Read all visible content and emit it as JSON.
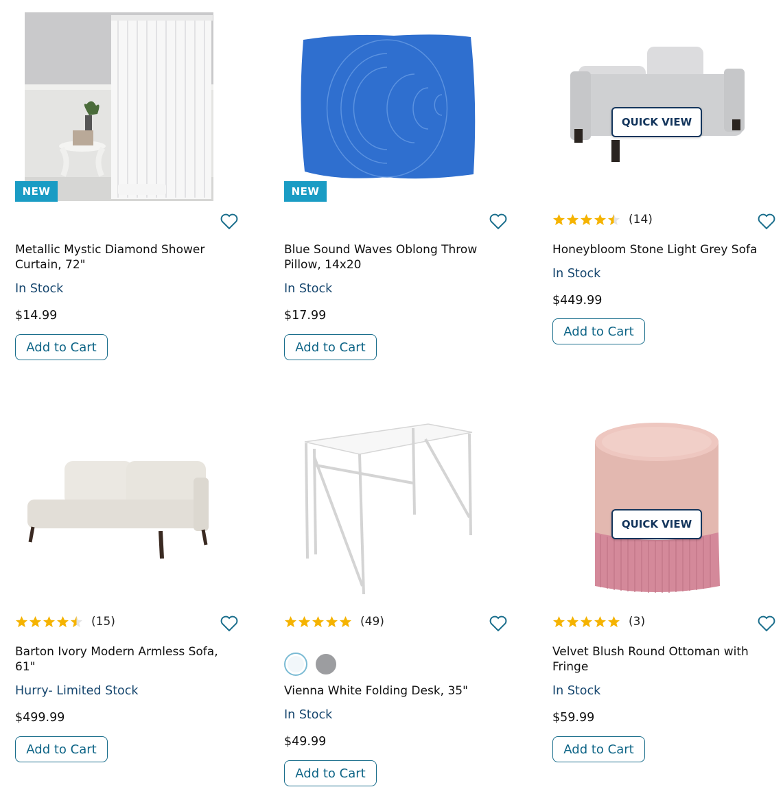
{
  "colors": {
    "accent": "#0d6486",
    "badge": "#1a9cc4",
    "stock": "#16466e",
    "star": "#f5b301"
  },
  "products": [
    {
      "badge": "NEW",
      "title": "Metallic Mystic Diamond Shower Curtain, 72\"",
      "stock": "In Stock",
      "price": "$14.99",
      "cart": "Add to Cart"
    },
    {
      "badge": "NEW",
      "title": "Blue Sound Waves Oblong Throw Pillow, 14x20",
      "stock": "In Stock",
      "price": "$17.99",
      "cart": "Add to Cart"
    },
    {
      "quick_view": "QUICK VIEW",
      "rating": 4.5,
      "rating_count": "(14)",
      "title": "Honeybloom Stone Light Grey Sofa",
      "stock": "In Stock",
      "price": "$449.99",
      "cart": "Add to Cart"
    },
    {
      "rating": 4.5,
      "rating_count": "(15)",
      "title": "Barton Ivory Modern Armless Sofa, 61\"",
      "stock": "Hurry- Limited Stock",
      "price": "$499.99",
      "cart": "Add to Cart"
    },
    {
      "rating": 5,
      "rating_count": "(49)",
      "swatches": [
        "white",
        "grey"
      ],
      "title": "Vienna White Folding Desk, 35\"",
      "stock": "In Stock",
      "price": "$49.99",
      "cart": "Add to Cart"
    },
    {
      "quick_view": "QUICK VIEW",
      "rating": 5,
      "rating_count": "(3)",
      "title": "Velvet Blush Round Ottoman with Fringe",
      "stock": "In Stock",
      "price": "$59.99",
      "cart": "Add to Cart"
    }
  ]
}
